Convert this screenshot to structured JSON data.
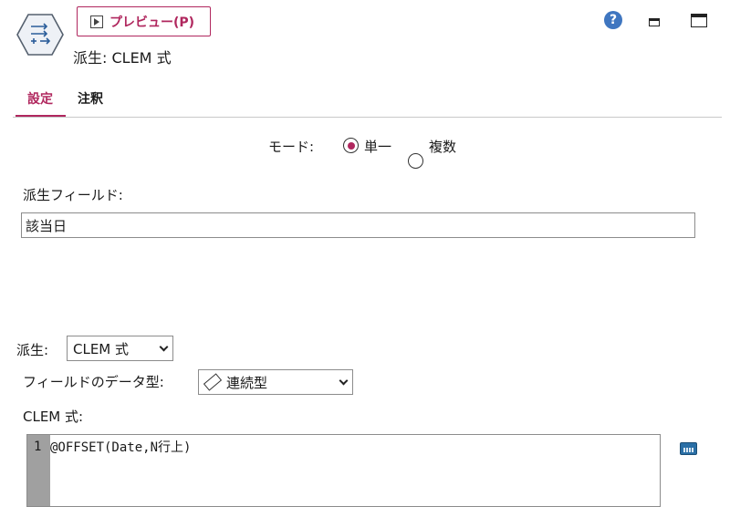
{
  "header": {
    "preview_label": "プレビュー(P)",
    "node_title": "派生: CLEM 式",
    "help_icon_text": "?"
  },
  "tabs": [
    {
      "label": "設定",
      "active": true
    },
    {
      "label": "注釈",
      "active": false
    }
  ],
  "mode": {
    "label": "モード:",
    "options": [
      {
        "label": "単一",
        "selected": true
      },
      {
        "label": "複数",
        "selected": false
      }
    ]
  },
  "derive_field": {
    "label": "派生フィールド:",
    "value": "該当日"
  },
  "derive_as": {
    "label": "派生:",
    "selected": "CLEM 式"
  },
  "field_type": {
    "label": "フィールドのデータ型:",
    "selected": "連続型",
    "icon": "ruler-icon"
  },
  "expression": {
    "label": "CLEM 式:",
    "line_number": "1",
    "code": "@OFFSET(Date,N行上)"
  },
  "colors": {
    "accent": "#b0275e",
    "help": "#3f76c0"
  }
}
